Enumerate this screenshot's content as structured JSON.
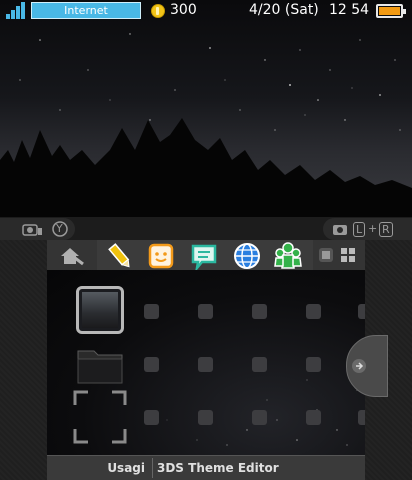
{
  "status_bar": {
    "connection_label": "Internet",
    "coins": "300",
    "date": "4/20 (Sat)",
    "time": "12 54",
    "battery_color": "#f29a12"
  },
  "mid_bar": {
    "left_button_glyph": "Y",
    "right_button_glyphs": [
      "L",
      "+",
      "R"
    ]
  },
  "shelf_icons": [
    {
      "name": "notes-icon",
      "color": "#f0c20e"
    },
    {
      "name": "friend-list-icon",
      "color": "#f39a1a"
    },
    {
      "name": "notifications-icon",
      "color": "#2bb8a0"
    },
    {
      "name": "internet-browser-icon",
      "color": "#2a7fe0"
    },
    {
      "name": "miiverse-icon",
      "color": "#34b24a"
    }
  ],
  "footer": {
    "author": "Usagi",
    "title": "3DS Theme Editor"
  },
  "colors": {
    "accent_blue": "#49b8e6"
  }
}
